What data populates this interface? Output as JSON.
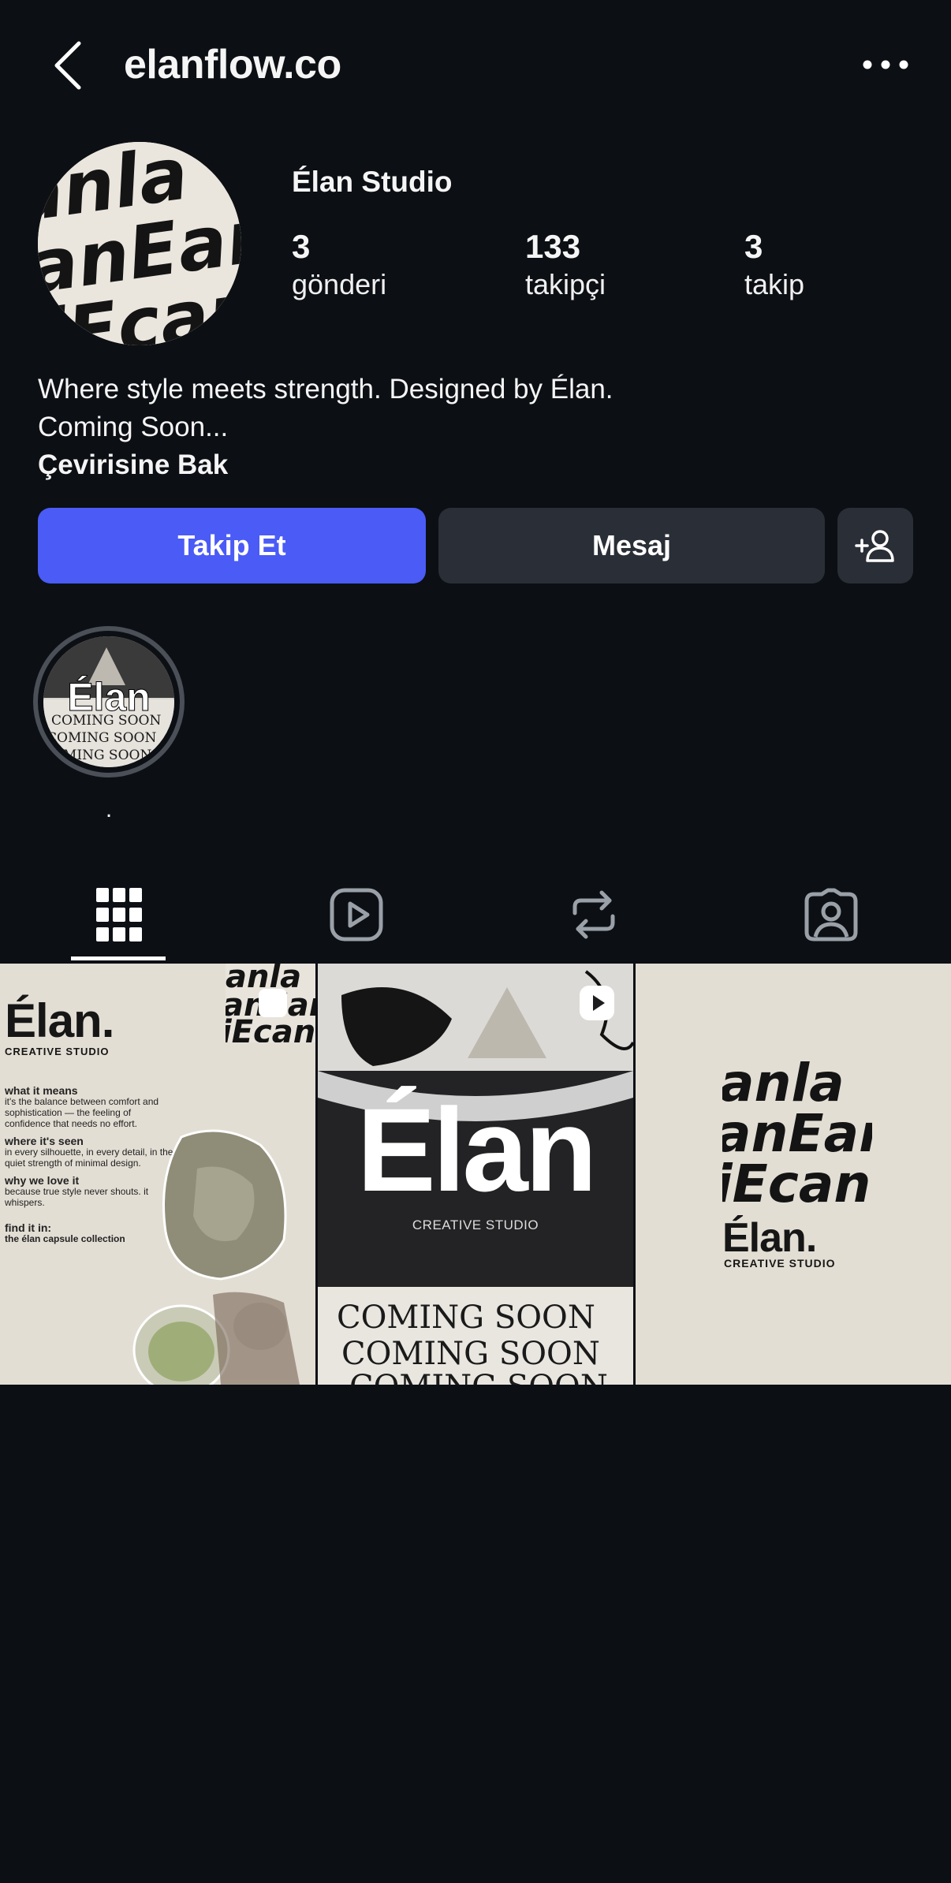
{
  "header": {
    "handle": "elanflow.co"
  },
  "profile": {
    "display_name": "Élan Studio",
    "stats": [
      {
        "value": "3",
        "label": "gönderi"
      },
      {
        "value": "133",
        "label": "takipçi"
      },
      {
        "value": "3",
        "label": "takip"
      }
    ],
    "bio_lines": [
      "Where style meets strength. Designed by Élan.",
      "Coming Soon..."
    ],
    "translate_link": "Çevirisine Bak"
  },
  "actions": {
    "follow_label": "Takip Et",
    "message_label": "Mesaj"
  },
  "highlights": [
    {
      "title": ".",
      "cover_text": "Élan",
      "cover_subtext": "COMING SOON"
    }
  ],
  "tabs": [
    {
      "icon": "grid-icon",
      "active": true
    },
    {
      "icon": "reels-icon",
      "active": false
    },
    {
      "icon": "reposts-icon",
      "active": false
    },
    {
      "icon": "tagged-icon",
      "active": false
    }
  ],
  "posts": [
    {
      "brand": "Élan.",
      "subtitle": "CREATIVE STUDIO",
      "sections": [
        {
          "heading": "what it means",
          "body": "it's the balance between comfort and sophistication — the feeling of confidence that needs no effort."
        },
        {
          "heading": "where it's seen",
          "body": "in every silhouette, in every detail, in the quiet strength of minimal design."
        },
        {
          "heading": "why we love it",
          "body": "because true style never shouts. it whispers."
        },
        {
          "heading": "find it in:",
          "body": "the élan capsule collection"
        }
      ],
      "badge_icon": "carousel-icon"
    },
    {
      "brand": "Élan",
      "subtitle": "CREATIVE STUDIO",
      "overlay_text": "COMING SOON",
      "badge_icon": "reel-icon"
    },
    {
      "brand": "Élan.",
      "subtitle": "CREATIVE STUDIO",
      "pattern_text": "anEan"
    }
  ],
  "colors": {
    "background": "#0c0f14",
    "primary_button": "#4a5bf6",
    "secondary_button": "#2a2e36",
    "post_cream": "#e3ded4"
  }
}
